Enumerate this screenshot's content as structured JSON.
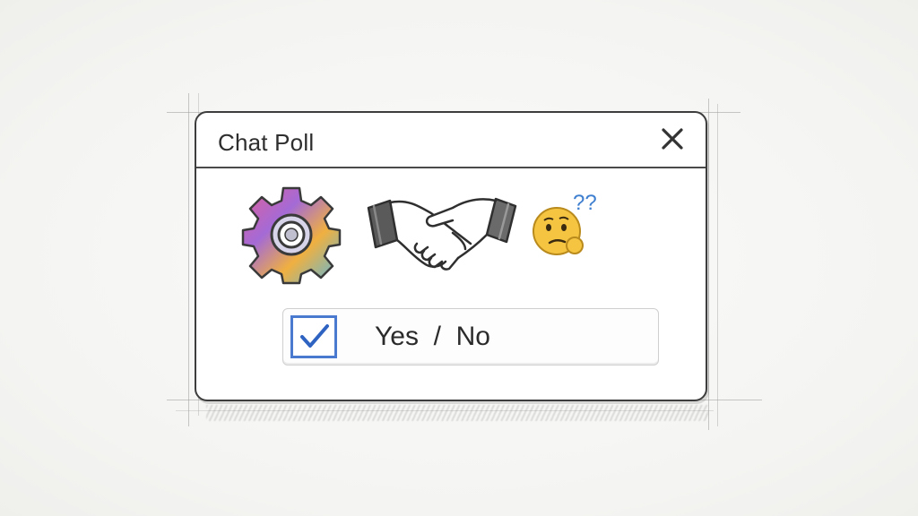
{
  "dialog": {
    "title": "Chat Poll",
    "close_icon": "close-icon"
  },
  "icons": [
    {
      "name": "gear-icon",
      "colors": [
        "#e0609a",
        "#a46ad6",
        "#f0b040",
        "#58b8e0"
      ]
    },
    {
      "name": "handshake-icon"
    },
    {
      "name": "confused-face-icon",
      "marks": "??",
      "marks_color": "#3f7fd0",
      "face_color": "#f5c542"
    }
  ],
  "poll": {
    "checked": true,
    "option_text": "Yes  /  No",
    "checkbox_color": "#4a7ad0"
  }
}
